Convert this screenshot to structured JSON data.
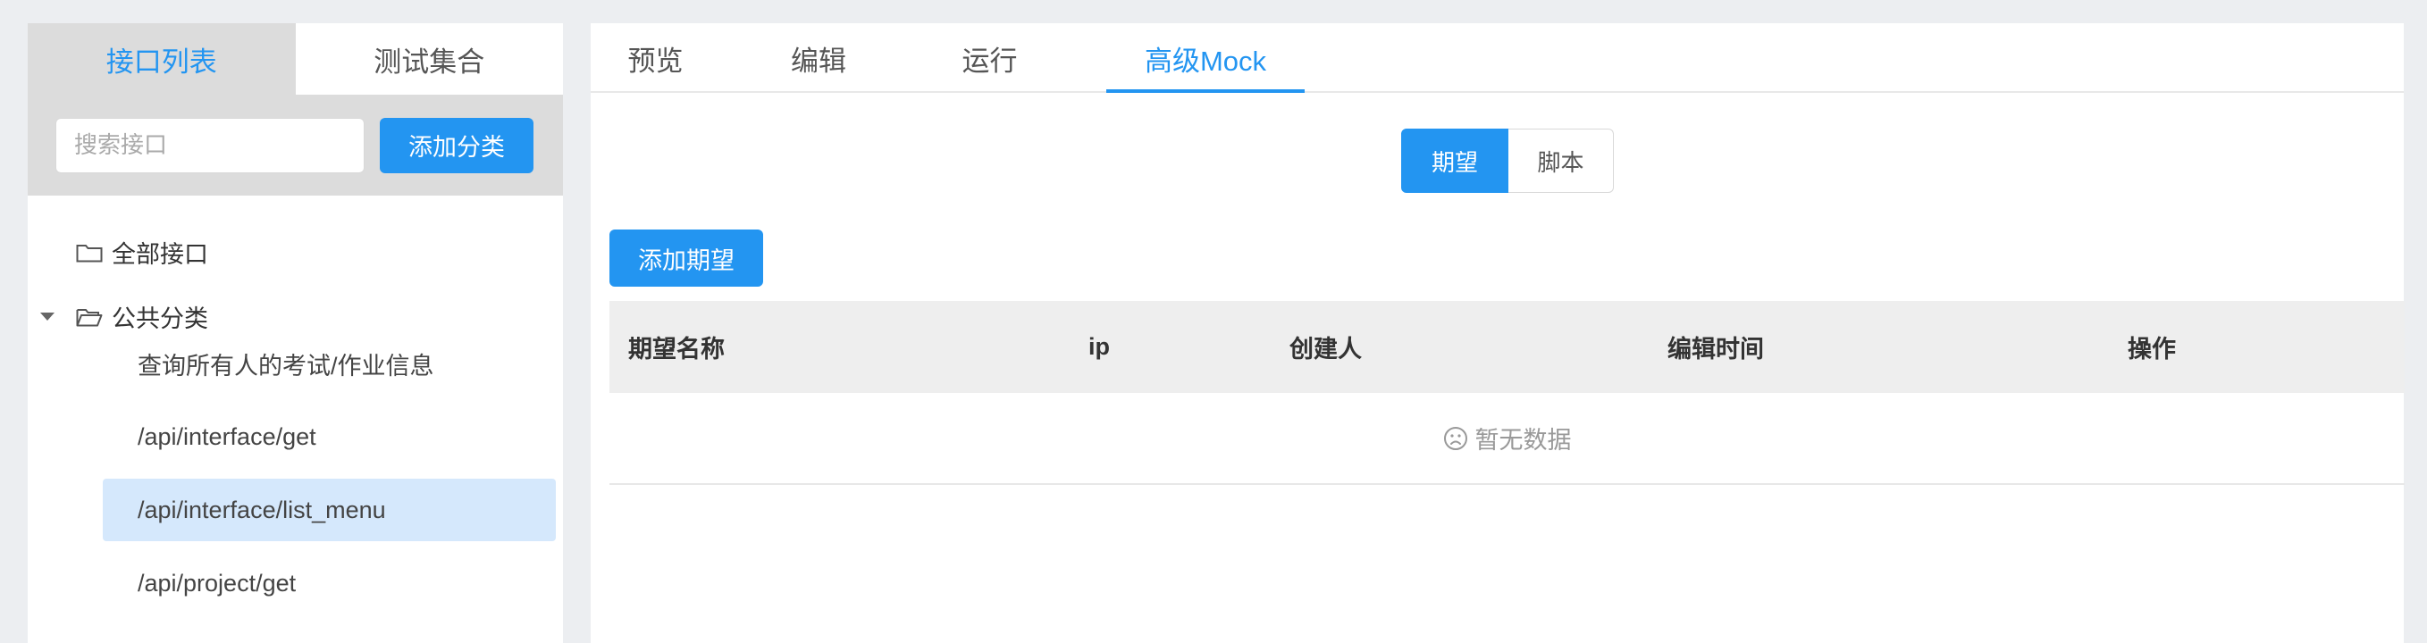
{
  "sidebar": {
    "tabs": [
      {
        "label": "接口列表"
      },
      {
        "label": "测试集合"
      }
    ],
    "search": {
      "placeholder": "搜索接口",
      "value": ""
    },
    "add_category_label": "添加分类",
    "tree": {
      "all_label": "全部接口",
      "category_label": "公共分类",
      "items": [
        {
          "label": "查询所有人的考试/作业信息",
          "selected": false
        },
        {
          "label": "/api/interface/get",
          "selected": false
        },
        {
          "label": "/api/interface/list_menu",
          "selected": true
        },
        {
          "label": "/api/project/get",
          "selected": false
        }
      ]
    }
  },
  "main": {
    "tabs": [
      {
        "label": "预览"
      },
      {
        "label": "编辑"
      },
      {
        "label": "运行"
      },
      {
        "label": "高级Mock"
      }
    ],
    "active_tab": "高级Mock",
    "segment": {
      "options": [
        {
          "label": "期望"
        },
        {
          "label": "脚本"
        }
      ],
      "selected": "期望"
    },
    "add_expect_label": "添加期望",
    "table": {
      "columns": [
        {
          "label": "期望名称"
        },
        {
          "label": "ip"
        },
        {
          "label": "创建人"
        },
        {
          "label": "编辑时间"
        },
        {
          "label": "操作"
        }
      ],
      "empty_text": "暂无数据"
    }
  },
  "colors": {
    "accent": "#2395f1",
    "selected_row": "#d5e8fc",
    "header_bg": "#eeeeee",
    "sidebar_gray": "#dcdcdc",
    "page_bg": "#eceef1"
  },
  "icons": [
    "folder-icon",
    "folder-open-icon",
    "caret-down-icon",
    "frown-icon"
  ]
}
